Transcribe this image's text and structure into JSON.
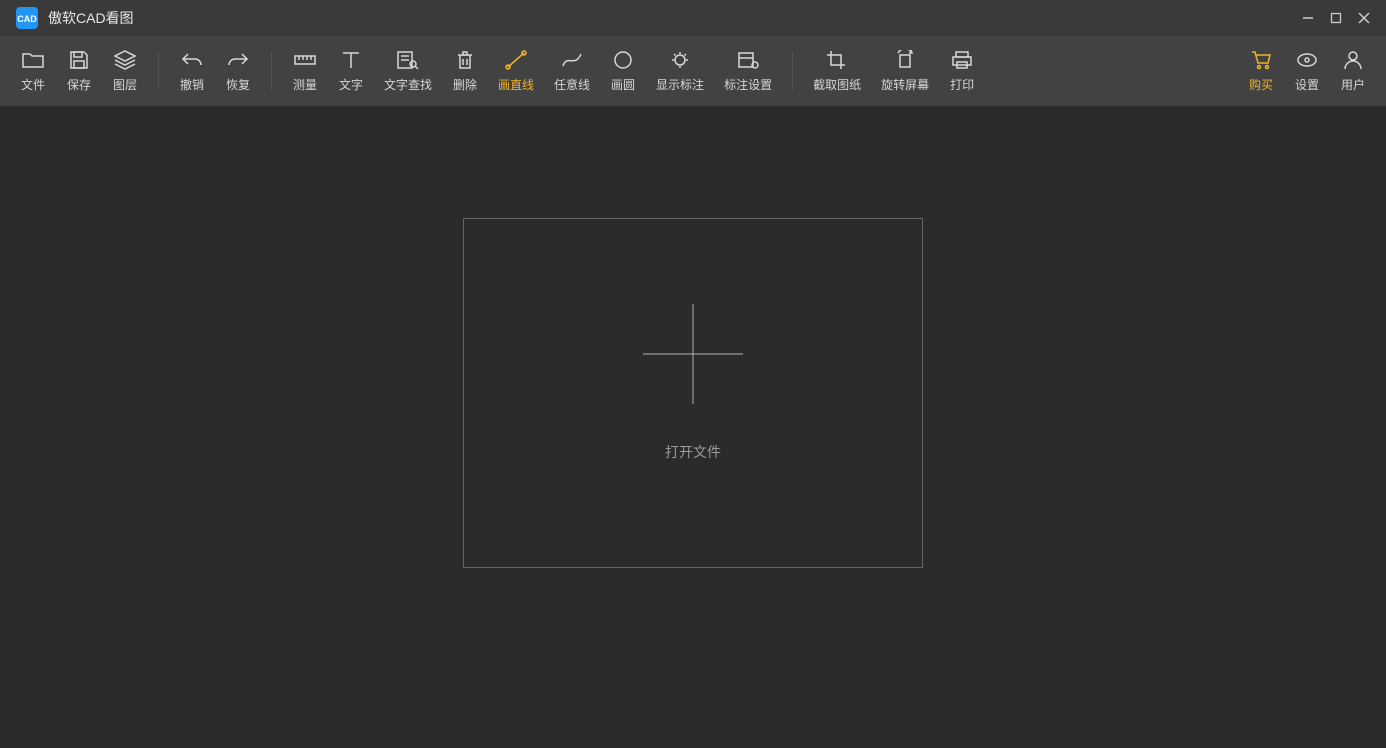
{
  "titlebar": {
    "app_name": "傲软CAD看图",
    "logo_text": "CAD"
  },
  "toolbar": {
    "file": "文件",
    "save": "保存",
    "layers": "图层",
    "undo": "撤销",
    "redo": "恢复",
    "measure": "测量",
    "text": "文字",
    "text_search": "文字查找",
    "delete": "删除",
    "draw_line": "画直线",
    "free_line": "任意线",
    "draw_circle": "画圆",
    "show_annotations": "显示标注",
    "annotation_settings": "标注设置",
    "crop_drawing": "截取图纸",
    "rotate_screen": "旋转屏幕",
    "print": "打印",
    "purchase": "购买",
    "settings": "设置",
    "user": "用户"
  },
  "canvas": {
    "open_file_label": "打开文件"
  },
  "colors": {
    "accent": "#f0b429",
    "bg_dark": "#2b2b2b",
    "bg_toolbar": "#424242",
    "bg_titlebar": "#3a3a3a"
  }
}
